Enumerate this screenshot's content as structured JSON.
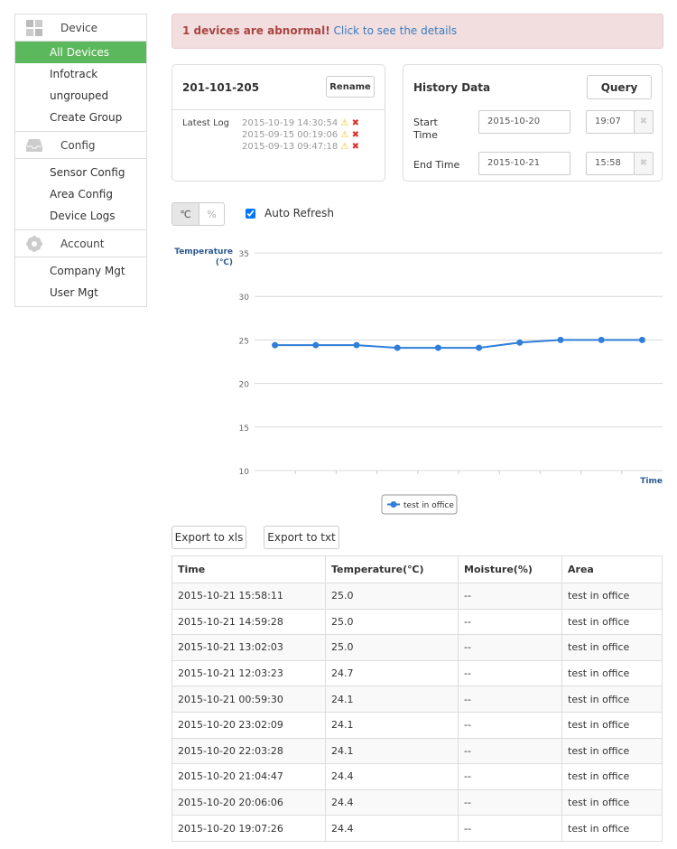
{
  "sidebar": {
    "sections": [
      {
        "label": "Device",
        "icon": "grid-icon",
        "items": [
          "All Devices",
          "Infotrack",
          "ungrouped",
          "Create Group"
        ]
      },
      {
        "label": "Config",
        "icon": "inbox-icon",
        "items": [
          "Sensor Config",
          "Area Config",
          "Device Logs"
        ]
      },
      {
        "label": "Account",
        "icon": "gear-icon",
        "items": [
          "Company Mgt",
          "User Mgt"
        ]
      }
    ],
    "active": "All Devices",
    "active_color": "#5cb85c"
  },
  "alert": {
    "bold": "1 devices are abnormal!",
    "link": "Click to see the details"
  },
  "device": {
    "name": "201-101-205",
    "rename_label": "Rename",
    "log_label": "Latest Log",
    "logs": [
      "2015-10-19 14:30:54",
      "2015-09-15 00:19:06",
      "2015-09-13 09:47:18"
    ]
  },
  "history": {
    "title": "History Data",
    "query_label": "Query",
    "start_label": "Start Time",
    "end_label": "End Time",
    "start_date": "2015-10-20",
    "start_time": "19:07",
    "end_date": "2015-10-21",
    "end_time": "15:58"
  },
  "controls": {
    "unit_c": "℃",
    "unit_pct": "%",
    "auto_refresh": "Auto Refresh",
    "auto_refresh_checked": true
  },
  "chart_data": {
    "type": "line",
    "ylabel": "Temperature (℃)",
    "xlabel": "Time",
    "ylim": [
      10,
      35
    ],
    "yticks": [
      10,
      15,
      20,
      25,
      30,
      35
    ],
    "grid": true,
    "legend": "bottom-center",
    "series": [
      {
        "name": "test in office",
        "color": "#2f7ed8",
        "values": [
          24.4,
          24.4,
          24.4,
          24.1,
          24.1,
          24.1,
          24.7,
          25.0,
          25.0,
          25.0
        ]
      }
    ]
  },
  "export": {
    "xls": "Export to xls",
    "txt": "Export to txt"
  },
  "table": {
    "headers": [
      "Time",
      "Temperature(℃)",
      "Moisture(%)",
      "Area"
    ],
    "rows": [
      [
        "2015-10-21 15:58:11",
        "25.0",
        "--",
        "test in office"
      ],
      [
        "2015-10-21 14:59:28",
        "25.0",
        "--",
        "test in office"
      ],
      [
        "2015-10-21 13:02:03",
        "25.0",
        "--",
        "test in office"
      ],
      [
        "2015-10-21 12:03:23",
        "24.7",
        "--",
        "test in office"
      ],
      [
        "2015-10-21 00:59:30",
        "24.1",
        "--",
        "test in office"
      ],
      [
        "2015-10-20 23:02:09",
        "24.1",
        "--",
        "test in office"
      ],
      [
        "2015-10-20 22:03:28",
        "24.1",
        "--",
        "test in office"
      ],
      [
        "2015-10-20 21:04:47",
        "24.4",
        "--",
        "test in office"
      ],
      [
        "2015-10-20 20:06:06",
        "24.4",
        "--",
        "test in office"
      ],
      [
        "2015-10-20 19:07:26",
        "24.4",
        "--",
        "test in office"
      ]
    ]
  }
}
